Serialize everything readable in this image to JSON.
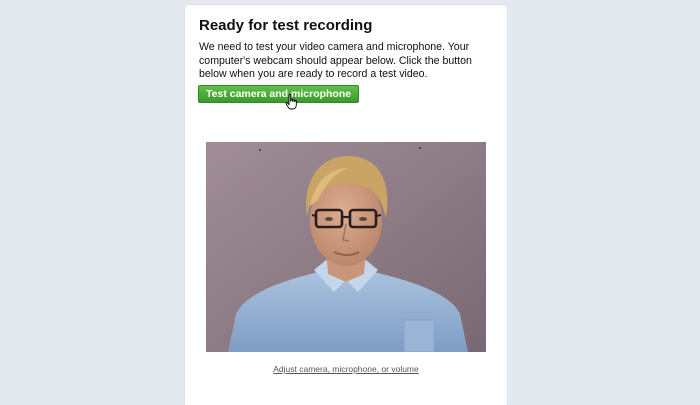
{
  "dialog": {
    "title": "Ready for test recording",
    "description": "We need to test your video camera and microphone. Your computer's webcam should appear below. Click the button below when you are ready to record a test video.",
    "test_button_label": "Test camera and microphone",
    "adjust_link_label": "Adjust camera, microphone, or volume"
  },
  "colors": {
    "page_background": "#e4e9f0",
    "button_green": "#44a535"
  },
  "icons": {
    "cursor": "hand-pointer-icon"
  }
}
